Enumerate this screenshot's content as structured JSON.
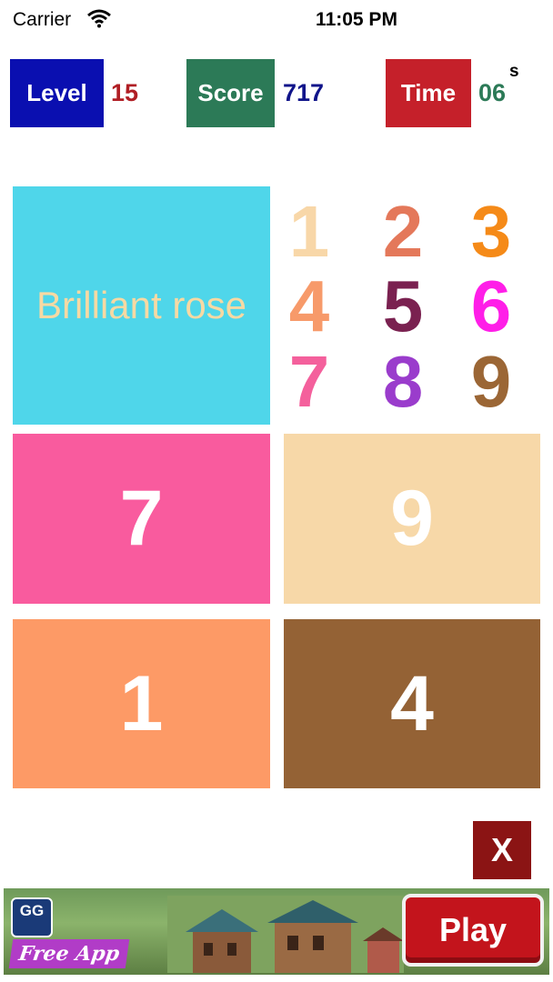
{
  "status_bar": {
    "carrier": "Carrier",
    "time": "11:05 PM"
  },
  "hud": {
    "level_label": "Level",
    "level_value": "15",
    "level_box_color": "#0a0fb0",
    "level_value_color": "#b01e24",
    "score_label": "Score",
    "score_value": "717",
    "score_box_color": "#2c7a57",
    "score_value_color": "#10148a",
    "time_label": "Time",
    "time_value": "06",
    "time_unit": "s",
    "time_box_color": "#c5202a",
    "time_value_color": "#2c7a57"
  },
  "word_card": {
    "text": "Brilliant rose",
    "background": "#4fd6ea",
    "text_color": "#f7d9a3"
  },
  "digit_grid": [
    {
      "digit": "1",
      "color": "#f8d7a8"
    },
    {
      "digit": "2",
      "color": "#e4785a"
    },
    {
      "digit": "3",
      "color": "#f58a18"
    },
    {
      "digit": "4",
      "color": "#f79a6a"
    },
    {
      "digit": "5",
      "color": "#7a2150"
    },
    {
      "digit": "6",
      "color": "#ff1ee8"
    },
    {
      "digit": "7",
      "color": "#f4609c"
    },
    {
      "digit": "8",
      "color": "#9a3ccc"
    },
    {
      "digit": "9",
      "color": "#9b6635"
    }
  ],
  "answer_tiles": [
    {
      "digit": "7",
      "color": "#f95b9e"
    },
    {
      "digit": "9",
      "color": "#f7d8a8"
    },
    {
      "digit": "1",
      "color": "#fd9a66"
    },
    {
      "digit": "4",
      "color": "#946235"
    }
  ],
  "close_button": {
    "label": "X"
  },
  "ad": {
    "logo_text": "GG",
    "free_text": "Free App",
    "play_label": "Play"
  }
}
